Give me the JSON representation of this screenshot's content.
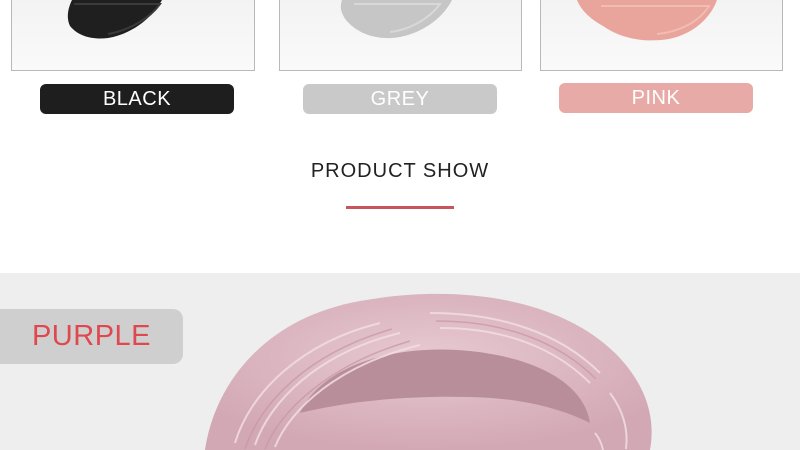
{
  "swatches": [
    {
      "label": "BLACK",
      "pill_color": "#1e1e1e",
      "product_color": "#222222"
    },
    {
      "label": "GREY",
      "pill_color": "#c9c9c9",
      "product_color": "#c8c8c8"
    },
    {
      "label": "PINK",
      "pill_color": "#e7aaa7",
      "product_color": "#e9a59c"
    }
  ],
  "section": {
    "title": "PRODUCT SHOW",
    "accent_color": "#c8545d"
  },
  "showcase": {
    "variant_label": "PURPLE",
    "variant_label_color": "#e0474f",
    "product_color": "#dfbcc6",
    "background_color": "#eeeeee"
  }
}
